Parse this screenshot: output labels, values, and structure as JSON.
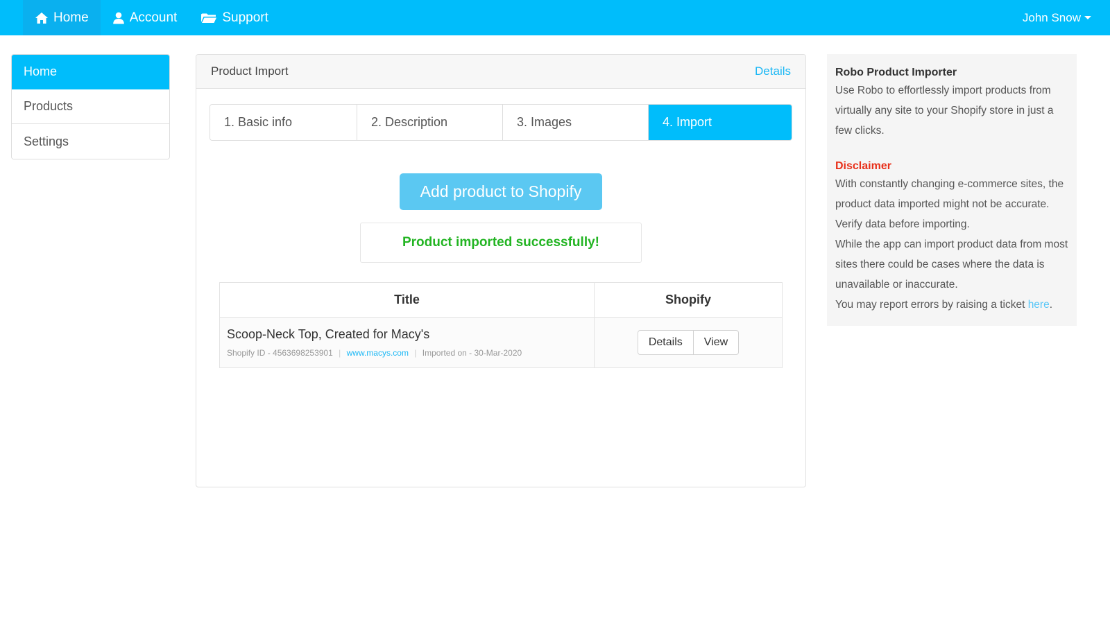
{
  "navbar": {
    "brand_items": [
      {
        "label": "Home",
        "icon": "home-icon",
        "active": true
      },
      {
        "label": "Account",
        "icon": "user-icon",
        "active": false
      },
      {
        "label": "Support",
        "icon": "folder-open-icon",
        "active": false
      }
    ],
    "user": {
      "name": "John Snow",
      "caret": "caret-down-icon"
    },
    "bg_color": "#00bdfb",
    "active_bg_color": "#0ab0ef"
  },
  "sidebar": {
    "items": [
      {
        "label": "Home",
        "active": true
      },
      {
        "label": "Products",
        "active": false
      },
      {
        "label": "Settings",
        "active": false
      }
    ]
  },
  "main": {
    "header": {
      "title": "Product Import",
      "details_link": "Details"
    },
    "steps": [
      {
        "label": "1. Basic info",
        "active": false
      },
      {
        "label": "2. Description",
        "active": false
      },
      {
        "label": "3. Images",
        "active": false
      },
      {
        "label": "4. Import",
        "active": true
      }
    ],
    "cta_button": "Add product to Shopify",
    "alert": {
      "message": "Product imported successfully!",
      "color": "#22b422"
    },
    "table": {
      "columns": [
        "Title",
        "Shopify"
      ],
      "rows": [
        {
          "title": "Scoop-Neck Top, Created for Macy's",
          "meta": {
            "shopify_id_label": "Shopify ID - 4563698253901",
            "source_link": "www.macys.com",
            "imported_on": "Imported on - 30-Mar-2020",
            "separator": "|"
          },
          "actions": [
            "Details",
            "View"
          ]
        }
      ]
    }
  },
  "info_panel": {
    "title": "Robo Product Importer",
    "intro": "Use Robo to effortlessly import products from virtually any site to your Shopify store in just a few clicks.",
    "disclaimer_title": "Disclaimer",
    "disclaimer_p1": "With constantly changing e-commerce sites, the product data imported might not be accurate. Verify data before importing.",
    "disclaimer_p2": "While the app can import product data from most sites there could be cases where the data is unavailable or inaccurate.",
    "report_prefix": "You may report errors by raising a ticket ",
    "report_link": "here",
    "report_suffix": ".",
    "title_color": "#333333",
    "disclaimer_color": "#e8301a"
  }
}
